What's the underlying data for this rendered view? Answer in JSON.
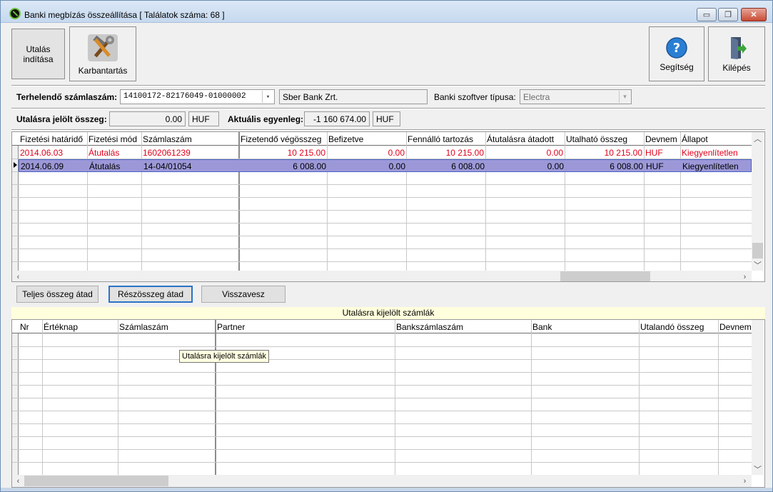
{
  "window": {
    "title": "Banki megbízás összeállítása [ Találatok száma: 68 ]",
    "minimize": "▭",
    "maximize": "❐",
    "close": "✕"
  },
  "toolbar": {
    "transfer": "Utalás indítása",
    "maintenance": "Karbantartás",
    "help": "Segítség",
    "exit": "Kilépés"
  },
  "account": {
    "label": "Terhelendő számlaszám:",
    "value": "14100172-82176049-01000002",
    "bank_name": "Sber Bank Zrt.",
    "software_label": "Banki szoftver típusa:",
    "software_value": "Electra"
  },
  "amounts": {
    "marked_label": "Utalásra jelölt összeg:",
    "marked_value": "0.00",
    "marked_currency": "HUF",
    "balance_label": "Aktuális egyenleg:",
    "balance_value": "-1 160 674.00",
    "balance_currency": "HUF"
  },
  "invoices": {
    "columns": [
      "Fizetési határidő",
      "Fizetési mód",
      "Számlaszám",
      "Fizetendő végösszeg",
      "Befizetve",
      "Fennálló tartozás",
      "Átutalásra átadott",
      "Utalható összeg",
      "Devnem",
      "Állapot"
    ],
    "rows": [
      [
        "2014.06.03",
        "Átutalás",
        "1602061239",
        "10 215.00",
        "0.00",
        "10 215.00",
        "0.00",
        "10 215.00",
        "HUF",
        "Kiegyenlítetlen"
      ],
      [
        "2014.06.09",
        "Átutalás",
        "14-04/01054",
        "6 008.00",
        "0.00",
        "6 008.00",
        "0.00",
        "6 008.00",
        "HUF",
        "Kiegyenlítetlen"
      ]
    ]
  },
  "actions": {
    "full": "Teljes összeg átad",
    "partial": "Részösszeg átad",
    "revoke": "Visszavesz"
  },
  "selected": {
    "title": "Utalásra kijelölt számlák",
    "columns": [
      "Nr",
      "Értéknap",
      "Számlaszám",
      "Partner",
      "Bankszámlaszám",
      "Bank",
      "Utalandó összeg",
      "Devnem"
    ],
    "tooltip": "Utalásra kijelölt számlák"
  },
  "colors": {
    "accent": "#2c72c7",
    "selected_row": "#9c98d8",
    "unpaid_text": "#e0001a"
  }
}
